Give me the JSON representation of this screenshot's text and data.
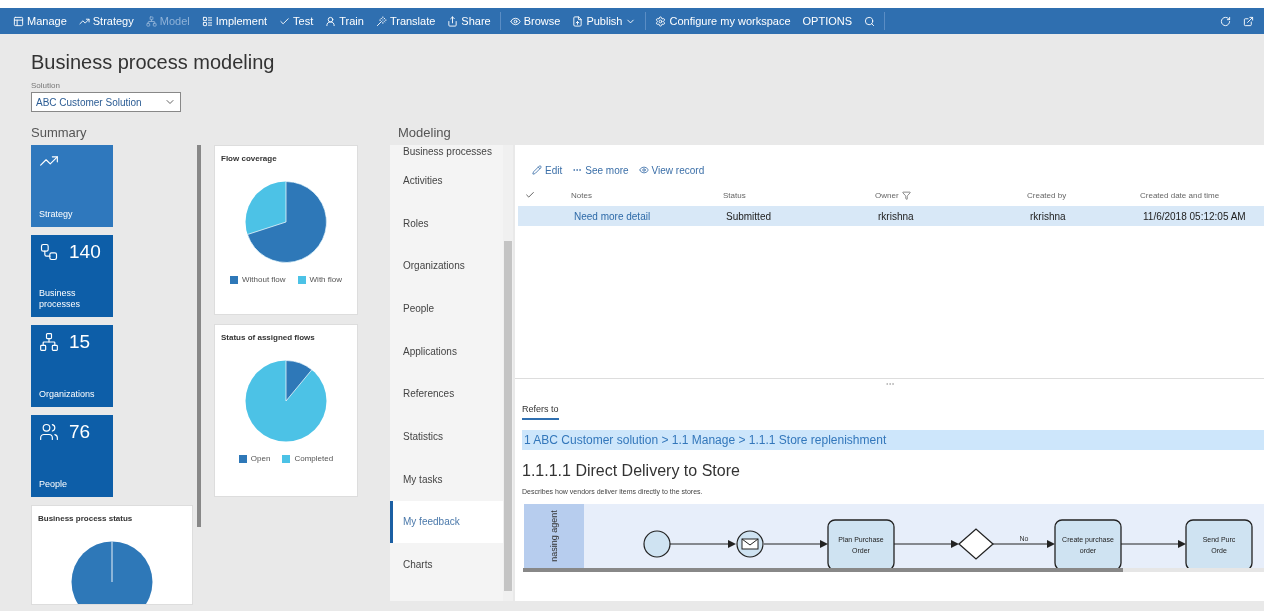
{
  "toolbar": {
    "groups": [
      [
        {
          "label": "Manage",
          "disabled": false,
          "menu": false
        },
        {
          "label": "Strategy",
          "disabled": false,
          "menu": false
        },
        {
          "label": "Model",
          "disabled": true,
          "menu": false
        },
        {
          "label": "Implement",
          "disabled": false,
          "menu": false
        },
        {
          "label": "Test",
          "disabled": false,
          "menu": false
        },
        {
          "label": "Train",
          "disabled": false,
          "menu": false
        },
        {
          "label": "Translate",
          "disabled": false,
          "menu": false
        },
        {
          "label": "Share",
          "disabled": false,
          "menu": false
        }
      ],
      [
        {
          "label": "Browse",
          "disabled": false,
          "menu": false
        },
        {
          "label": "Publish",
          "disabled": false,
          "menu": true
        }
      ],
      [
        {
          "label": "Configure my workspace",
          "disabled": false,
          "menu": false
        },
        {
          "label": "OPTIONS",
          "disabled": false,
          "menu": false
        }
      ]
    ]
  },
  "page_title": "Business process modeling",
  "solution": {
    "label": "Solution",
    "value": "ABC Customer Solution"
  },
  "summary": {
    "heading": "Summary",
    "tiles": [
      {
        "kind": "link",
        "label": "Strategy"
      },
      {
        "kind": "count",
        "count": "140",
        "label": "Business processes"
      },
      {
        "kind": "count",
        "count": "15",
        "label": "Organizations"
      },
      {
        "kind": "count",
        "count": "76",
        "label": "People"
      }
    ],
    "status_card": {
      "title": "Business process status"
    },
    "charts": [
      {
        "title": "Flow coverage",
        "legend": [
          {
            "label": "Without flow",
            "color": "#2e78b8"
          },
          {
            "label": "With flow",
            "color": "#4cc2e6"
          }
        ]
      },
      {
        "title": "Status of assigned flows",
        "legend": [
          {
            "label": "Open",
            "color": "#2e78b8"
          },
          {
            "label": "Completed",
            "color": "#4cc2e6"
          }
        ]
      }
    ]
  },
  "modeling": {
    "heading": "Modeling",
    "nav": [
      {
        "label": "Business processes",
        "selected": false
      },
      {
        "label": "Activities",
        "selected": false
      },
      {
        "label": "Roles",
        "selected": false
      },
      {
        "label": "Organizations",
        "selected": false
      },
      {
        "label": "People",
        "selected": false
      },
      {
        "label": "Applications",
        "selected": false
      },
      {
        "label": "References",
        "selected": false
      },
      {
        "label": "Statistics",
        "selected": false
      },
      {
        "label": "My tasks",
        "selected": false
      },
      {
        "label": "My feedback",
        "selected": true
      },
      {
        "label": "Charts",
        "selected": false
      }
    ],
    "actions": [
      {
        "label": "Edit"
      },
      {
        "label": "See more"
      },
      {
        "label": "View record"
      }
    ],
    "columns": [
      {
        "label": "Notes",
        "filtered": false
      },
      {
        "label": "Status",
        "filtered": false
      },
      {
        "label": "Owner",
        "filtered": true
      },
      {
        "label": "Created by",
        "filtered": false
      },
      {
        "label": "Created date and time",
        "filtered": false
      }
    ],
    "rows": [
      {
        "selected": true,
        "cells": [
          "Need more detail",
          "Submitted",
          "rkrishna",
          "rkrishna",
          "11/6/2018 05:12:05 AM"
        ]
      }
    ],
    "tab": {
      "label": "Refers to",
      "selected": true
    },
    "breadcrumb": "1 ABC Customer solution > 1.1 Manage > 1.1.1 Store replenishment",
    "process_title": "1.1.1.1 Direct Delivery to Store",
    "description": "Describes how vendors deliver items directly to the stores.",
    "diagram": {
      "lane": "nasing agent",
      "nodes": [
        {
          "kind": "start"
        },
        {
          "kind": "message"
        },
        {
          "kind": "task",
          "lines": [
            "Plan Purchase",
            "Order"
          ]
        },
        {
          "kind": "gateway"
        },
        {
          "kind": "task",
          "lines": [
            "Create purchase",
            "order"
          ],
          "in_label": "No"
        },
        {
          "kind": "task",
          "lines": [
            "Send Purc",
            "Orde"
          ]
        }
      ]
    }
  }
}
